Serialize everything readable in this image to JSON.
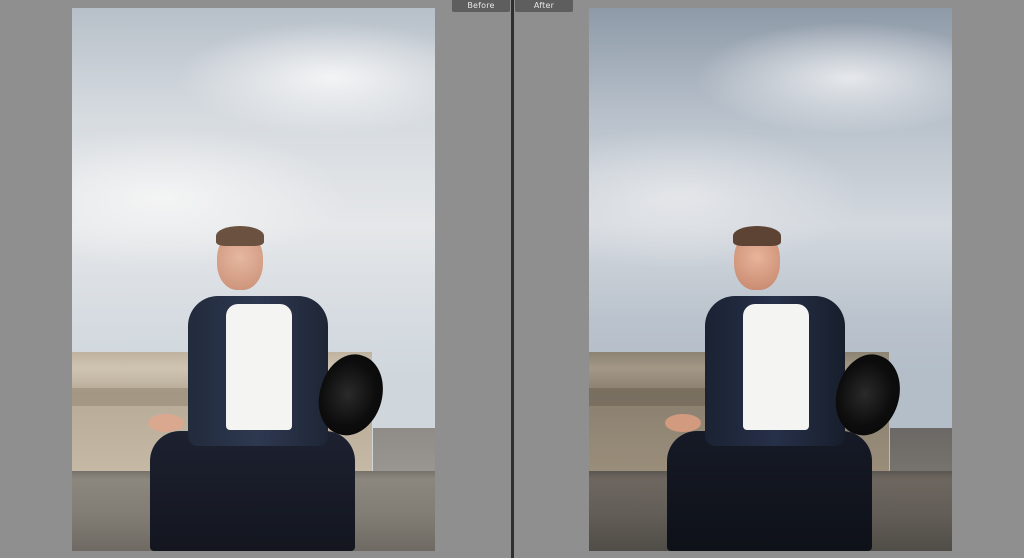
{
  "compare_view": {
    "before_label": "Before",
    "after_label": "After"
  },
  "colors": {
    "background": "#8f8f8f",
    "divider": "#2f2f2f",
    "label_bg": "#5e5e5e",
    "label_text": "#e6e6e6"
  }
}
